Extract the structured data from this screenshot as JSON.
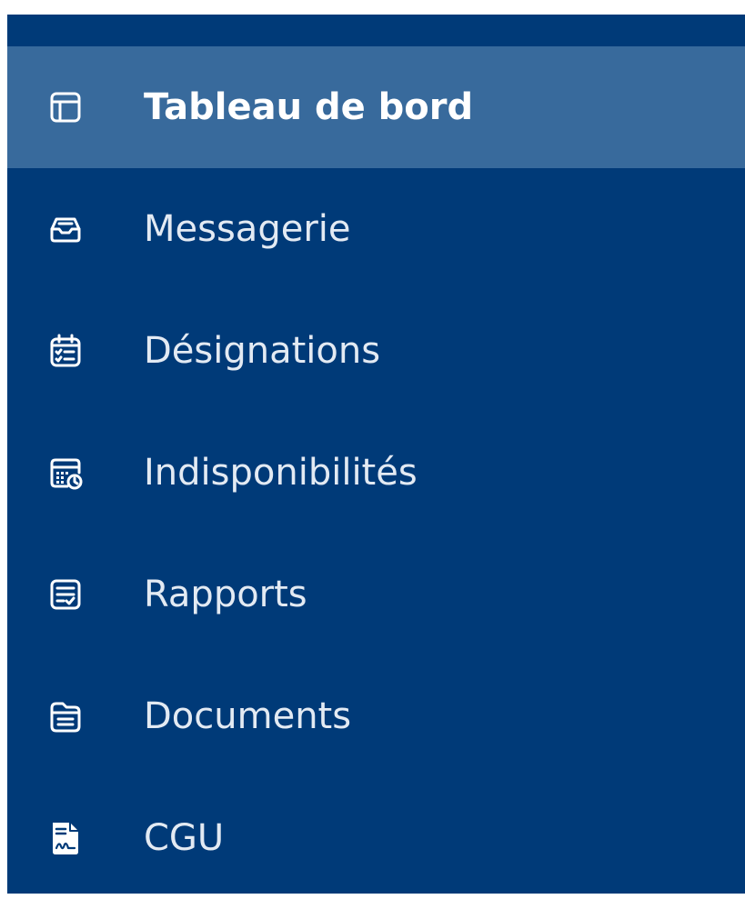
{
  "colors": {
    "sidebar_bg": "#003a78",
    "active_bg": "#386a9c",
    "text": "#e3eaf3",
    "active_text": "#ffffff"
  },
  "menu": {
    "items": [
      {
        "label": "Tableau de bord",
        "icon": "dashboard-icon",
        "active": true
      },
      {
        "label": "Messagerie",
        "icon": "inbox-icon",
        "active": false
      },
      {
        "label": "Désignations",
        "icon": "calendar-checklist-icon",
        "active": false
      },
      {
        "label": "Indisponibilités",
        "icon": "calendar-clock-icon",
        "active": false
      },
      {
        "label": "Rapports",
        "icon": "report-icon",
        "active": false
      },
      {
        "label": "Documents",
        "icon": "folder-document-icon",
        "active": false
      },
      {
        "label": "CGU",
        "icon": "signed-document-icon",
        "active": false
      }
    ]
  }
}
